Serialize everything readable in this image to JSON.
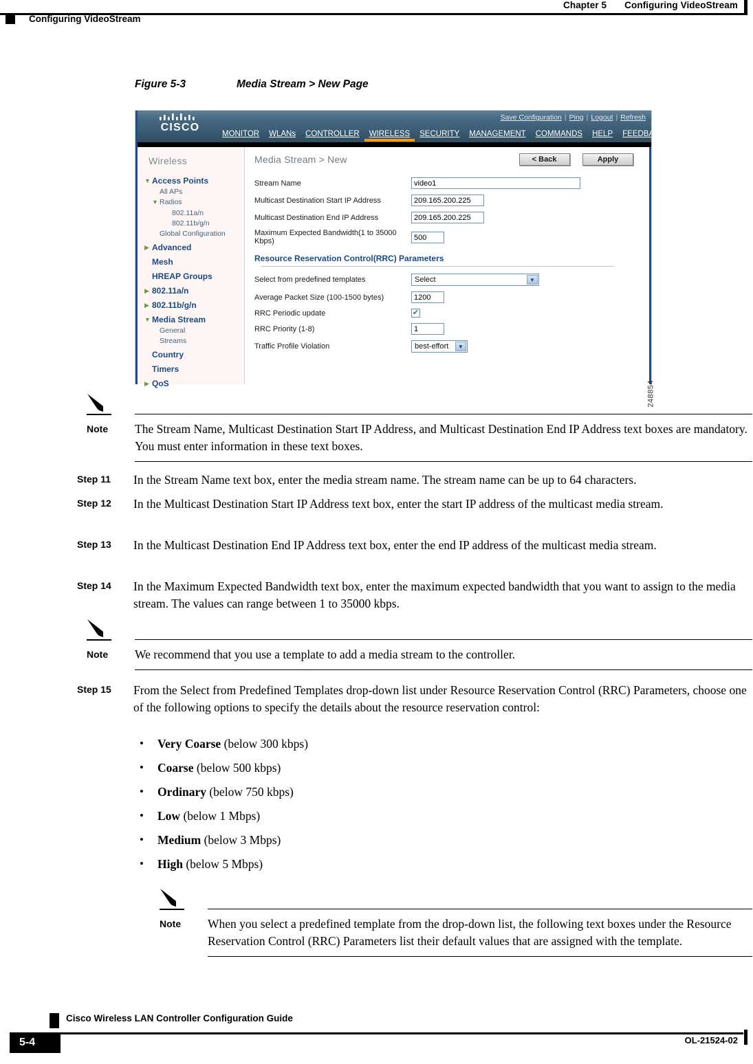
{
  "running_head": {
    "chapter": "Chapter 5",
    "chapter_title": "Configuring VideoStream",
    "left_title": "Configuring VideoStream"
  },
  "figure": {
    "caption_number": "Figure 5-3",
    "caption_title": "Media Stream > New Page",
    "figure_id": "248854",
    "app": {
      "top_links": [
        {
          "label": "Save Configuration"
        },
        {
          "label": "Ping"
        },
        {
          "label": "Logout"
        },
        {
          "label": "Refresh"
        }
      ],
      "brand": "CISCO",
      "main_nav": [
        {
          "label": "MONITOR",
          "active": false
        },
        {
          "label": "WLANs",
          "active": false
        },
        {
          "label": "CONTROLLER",
          "active": false
        },
        {
          "label": "WIRELESS",
          "active": true
        },
        {
          "label": "SECURITY",
          "active": false
        },
        {
          "label": "MANAGEMENT",
          "active": false
        },
        {
          "label": "COMMANDS",
          "active": false
        },
        {
          "label": "HELP",
          "active": false
        },
        {
          "label": "FEEDBACK",
          "active": false
        }
      ],
      "accent_color": "#f49a1b",
      "header_color": "#456880",
      "sidebar": {
        "title": "Wireless",
        "items": [
          {
            "label": "Access Points",
            "level": "top",
            "caret": "down"
          },
          {
            "label": "All APs",
            "level": "sub1"
          },
          {
            "label": "Radios",
            "level": "sub-caret",
            "caret": "down"
          },
          {
            "label": "802.11a/n",
            "level": "sub3"
          },
          {
            "label": "802.11b/g/n",
            "level": "sub3"
          },
          {
            "label": "Global Configuration",
            "level": "sub1"
          },
          {
            "label": "Advanced",
            "level": "top",
            "caret": "right"
          },
          {
            "label": "Mesh",
            "level": "top",
            "caret": "none"
          },
          {
            "label": "HREAP Groups",
            "level": "top",
            "caret": "none"
          },
          {
            "label": "802.11a/n",
            "level": "top",
            "caret": "right"
          },
          {
            "label": "802.11b/g/n",
            "level": "top",
            "caret": "right"
          },
          {
            "label": "Media Stream",
            "level": "top",
            "caret": "down"
          },
          {
            "label": "General",
            "level": "sub1"
          },
          {
            "label": "Streams",
            "level": "sub1"
          },
          {
            "label": "Country",
            "level": "top",
            "caret": "none"
          },
          {
            "label": "Timers",
            "level": "top",
            "caret": "none"
          },
          {
            "label": "QoS",
            "level": "top",
            "caret": "right"
          }
        ]
      },
      "content": {
        "title": "Media Stream > New",
        "back_button": "< Back",
        "apply_button": "Apply",
        "fields": [
          {
            "label": "Stream Name",
            "value": "video1",
            "control": "text",
            "width": "wide"
          },
          {
            "label": "Multicast Destination Start IP Address",
            "value": "209.165.200.225",
            "control": "text",
            "width": "ip"
          },
          {
            "label": "Multicast Destination End IP Address",
            "value": "209.165.200.225",
            "control": "text",
            "width": "ip"
          },
          {
            "label": "Maximum Expected Bandwidth(1 to 35000 Kbps)",
            "value": "500",
            "control": "text",
            "width": "num"
          }
        ],
        "rrc_section_title": "Resource Reservation Control(RRC) Parameters",
        "rrc_fields": [
          {
            "label": "Select from predefined templates",
            "value": "Select",
            "control": "select",
            "width": "wide"
          },
          {
            "label": "Average Packet Size (100-1500 bytes)",
            "value": "1200",
            "control": "text",
            "width": "num"
          },
          {
            "label": "RRC Periodic update",
            "value": "✔",
            "control": "checkbox",
            "checked": true
          },
          {
            "label": "RRC Priority (1-8)",
            "value": "1",
            "control": "text",
            "width": "num"
          },
          {
            "label": "Traffic Profile Violation",
            "value": "best-effort",
            "control": "select",
            "width": "small"
          }
        ]
      }
    }
  },
  "notes": [
    {
      "label": "Note",
      "text": "The Stream Name, Multicast Destination Start IP Address, and Multicast Destination End IP Address text boxes are mandatory. You must enter information in these text boxes."
    },
    {
      "label": "Note",
      "text": "We recommend that you use a template to add a media stream to the controller."
    },
    {
      "label": "Note",
      "text": "When you select a predefined template from the drop-down list, the following text boxes under the Resource Reservation Control (RRC) Parameters list their default values that are assigned with the template."
    }
  ],
  "steps": [
    {
      "label": "Step 11",
      "text": "In the Stream Name text box, enter the media stream name. The stream name can be up to 64 characters."
    },
    {
      "label": "Step 12",
      "text": "In the Multicast Destination Start IP Address text box, enter the start IP address of the multicast media stream."
    },
    {
      "label": "Step 13",
      "text": "In the Multicast Destination End IP Address text box, enter the end IP address of the multicast media stream."
    },
    {
      "label": "Step 14",
      "text": "In the Maximum Expected Bandwidth text box, enter the maximum expected bandwidth that you want to assign to the media stream. The values can range between 1 to 35000 kbps."
    },
    {
      "label": "Step 15",
      "text": "From the Select from Predefined Templates drop-down list under Resource Reservation Control (RRC) Parameters, choose one of the following options to specify the details about the resource reservation control:"
    }
  ],
  "bullets": [
    {
      "term": "Very Coarse",
      "detail": " (below 300 kbps)"
    },
    {
      "term": "Coarse",
      "detail": " (below 500 kbps)"
    },
    {
      "term": "Ordinary",
      "detail": " (below 750 kbps)"
    },
    {
      "term": "Low",
      "detail": " (below 1 Mbps)"
    },
    {
      "term": "Medium",
      "detail": " (below 3 Mbps)"
    },
    {
      "term": "High",
      "detail": " (below 5 Mbps)"
    }
  ],
  "footer": {
    "guide_title": "Cisco Wireless LAN Controller Configuration Guide",
    "page_number": "5-4",
    "doc_number": "OL-21524-02"
  }
}
